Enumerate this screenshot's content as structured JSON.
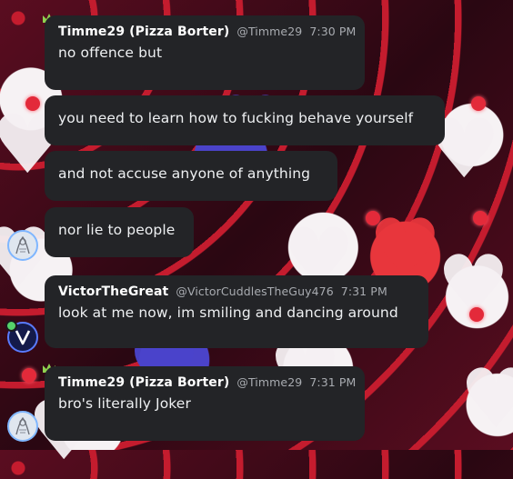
{
  "messages": [
    {
      "username": "Timme29 (Pizza Borter)",
      "handle": "@Timme29",
      "time": "7:30 PM",
      "lines": [
        "no offence but",
        "you need to learn how to fucking behave yourself",
        "and not accuse anyone of anything",
        "nor lie to people"
      ]
    },
    {
      "username": "VictorTheGreat",
      "handle": "@VictorCuddlesTheGuy476",
      "time": "7:31 PM",
      "lines": [
        "look at me now, im smiling and dancing around"
      ]
    },
    {
      "username": "Timme29 (Pizza Borter)",
      "handle": "@Timme29",
      "time": "7:31 PM",
      "lines": [
        "bro's literally Joker"
      ]
    }
  ],
  "colors": {
    "bubble": "#232427",
    "crown": "#8fd14f",
    "background": "#3a0a16"
  },
  "icons": [
    "crown-icon",
    "sketch-avatar",
    "victor-v-avatar"
  ]
}
